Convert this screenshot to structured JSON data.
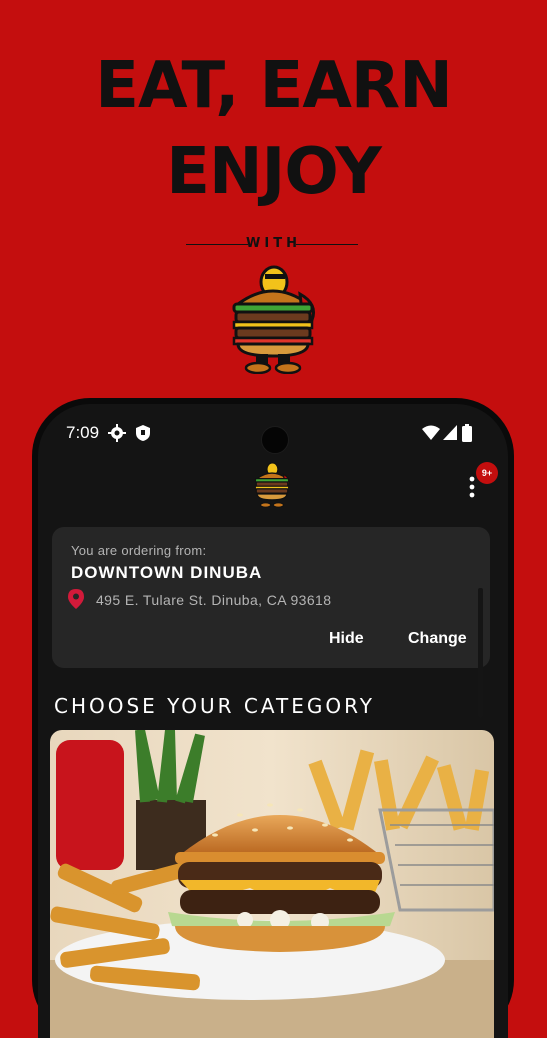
{
  "promo": {
    "headline_line1": "EAT, EARN",
    "headline_line2": "ENJOY",
    "with_text": "WITH"
  },
  "status_bar": {
    "time": "7:09",
    "icons": [
      "gear-icon",
      "shield-icon",
      "wifi-icon",
      "signal-icon",
      "battery-icon"
    ]
  },
  "header": {
    "logo": "burger-mascot",
    "notification_badge": "9+",
    "menu_icon": "more-vert-icon"
  },
  "location_card": {
    "label": "You are ordering from:",
    "store_name": "DOWNTOWN DINUBA",
    "address": "495 E. Tulare St. Dinuba, CA 93618",
    "hide_label": "Hide",
    "change_label": "Change"
  },
  "categories": {
    "title": "CHOOSE YOUR CATEGORY",
    "first_image": "cheeseburger-and-fries"
  },
  "colors": {
    "brand_red": "#c40e0e",
    "screen_bg": "#141414",
    "card_bg": "#262626",
    "pin_color": "#d21a3a"
  }
}
